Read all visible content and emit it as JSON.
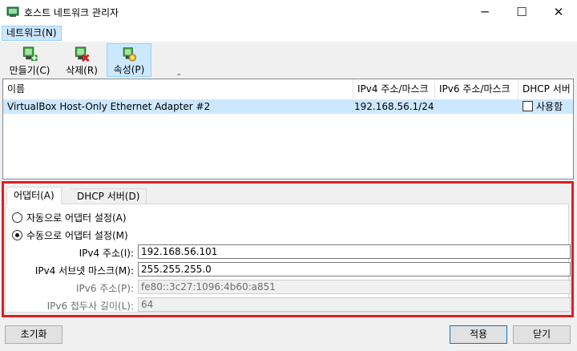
{
  "window": {
    "title": "호스트 네트워크 관리자",
    "minimize": "─",
    "maximize": "☐",
    "close": "✕"
  },
  "menu": {
    "network": "네트워크(N)"
  },
  "toolbar": {
    "create": "만들기(C)",
    "remove": "삭제(R)",
    "properties": "속성(P)"
  },
  "list": {
    "columns": [
      "이름",
      "IPv4 주소/마스크",
      "IPv6 주소/마스크",
      "DHCP 서버"
    ],
    "rows": [
      {
        "name": "VirtualBox Host-Only Ethernet Adapter #2",
        "ipv4": "192.168.56.1/24",
        "ipv6": "",
        "dhcp": "사용함"
      }
    ]
  },
  "tabs": {
    "adapter": "어댑터(A)",
    "dhcp": "DHCP 서버(D)"
  },
  "adapter": {
    "auto_label": "자동으로 어댑터 설정(A)",
    "manual_label": "수동으로 어댑터 설정(M)",
    "ipv4_addr_label": "IPv4 주소(I):",
    "ipv4_addr": "192.168.56.101",
    "ipv4_mask_label": "IPv4 서브넷 마스크(M):",
    "ipv4_mask": "255.255.255.0",
    "ipv6_addr_label": "IPv6 주소(P):",
    "ipv6_addr": "fe80::3c27:1096:4b60:a851",
    "ipv6_prefix_label": "IPv6 접두사 길이(L):",
    "ipv6_prefix": "64"
  },
  "buttons": {
    "reset": "초기화",
    "apply": "적용",
    "close": "닫기"
  }
}
